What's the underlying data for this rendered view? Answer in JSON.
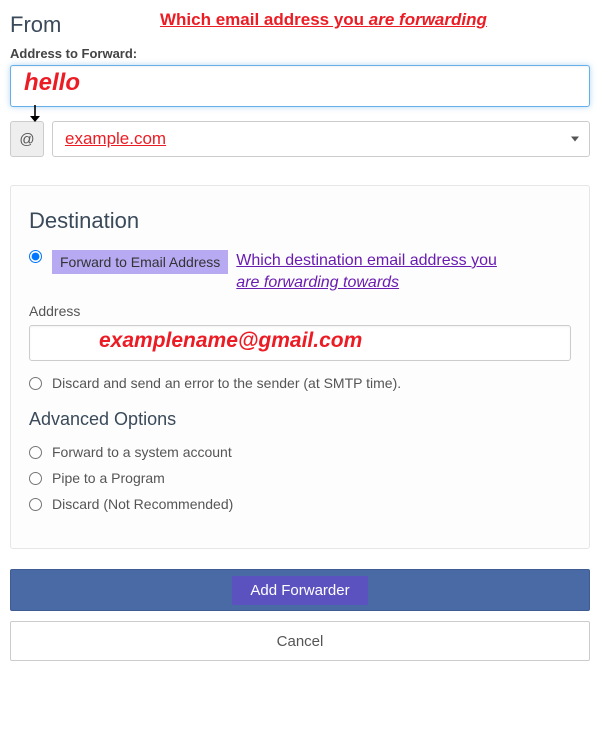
{
  "from": {
    "heading": "From",
    "annotation_prefix": "Which email address you ",
    "annotation_italic": "are forwarding",
    "label": "Address to Forward:",
    "input_value": "",
    "input_overlay": "hello",
    "at_symbol": "@",
    "domain": "example.com"
  },
  "destination": {
    "heading": "Destination",
    "radio_forward_label": "Forward to Email Address",
    "annotation_line1": "Which destination email address you",
    "annotation_line2_italic": "are forwarding towards",
    "address_label": "Address",
    "address_value": "",
    "address_overlay": "examplename@gmail.com",
    "radio_discard_label": "Discard and send an error to the sender (at SMTP time)."
  },
  "advanced": {
    "heading": "Advanced Options",
    "opt_system": "Forward to a system account",
    "opt_pipe": "Pipe to a Program",
    "opt_discard": "Discard (Not Recommended)"
  },
  "buttons": {
    "primary": "Add Forwarder",
    "cancel": "Cancel"
  }
}
